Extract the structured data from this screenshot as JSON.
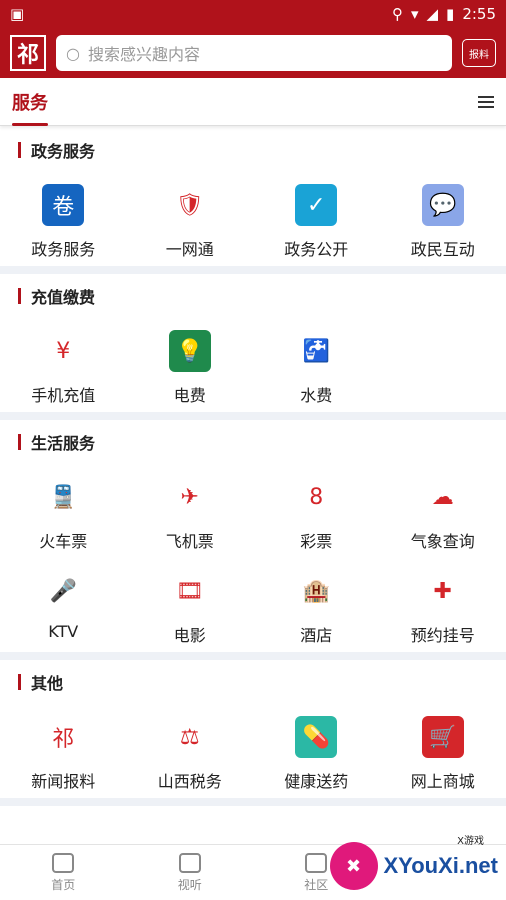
{
  "status_bar": {
    "time": "2:55"
  },
  "header": {
    "logo_char": "祁",
    "search_placeholder": "搜索感兴趣内容",
    "report_label": "报料"
  },
  "tabs": {
    "active": "服务"
  },
  "sections": [
    {
      "title": "政务服务",
      "items": [
        {
          "label": "政务服务",
          "icon": "gov-service-icon",
          "color": "#1565c0",
          "glyph": "卷"
        },
        {
          "label": "一网通",
          "icon": "police-badge-icon",
          "color": "#ffffff",
          "glyph": "🛡"
        },
        {
          "label": "政务公开",
          "icon": "check-circle-icon",
          "color": "#1aa3d6",
          "glyph": "✓"
        },
        {
          "label": "政民互动",
          "icon": "chat-bubble-icon",
          "color": "#8aa6e8",
          "glyph": "💬"
        }
      ]
    },
    {
      "title": "充值缴费",
      "items": [
        {
          "label": "手机充值",
          "icon": "phone-recharge-icon",
          "color": "#ffffff",
          "glyph": "¥"
        },
        {
          "label": "电费",
          "icon": "electricity-icon",
          "color": "#1f8a4c",
          "glyph": "💡"
        },
        {
          "label": "水费",
          "icon": "water-tap-icon",
          "color": "#ffffff",
          "glyph": "🚰"
        }
      ]
    },
    {
      "title": "生活服务",
      "items": [
        {
          "label": "火车票",
          "icon": "train-icon",
          "color": "#ffffff",
          "glyph": "🚆"
        },
        {
          "label": "飞机票",
          "icon": "airplane-icon",
          "color": "#ffffff",
          "glyph": "✈"
        },
        {
          "label": "彩票",
          "icon": "lottery-icon",
          "color": "#ffffff",
          "glyph": "8"
        },
        {
          "label": "气象查询",
          "icon": "cloud-icon",
          "color": "#ffffff",
          "glyph": "☁"
        },
        {
          "label": "KTV",
          "icon": "microphone-icon",
          "color": "#ffffff",
          "glyph": "🎤"
        },
        {
          "label": "电影",
          "icon": "film-reel-icon",
          "color": "#ffffff",
          "glyph": "🎞"
        },
        {
          "label": "酒店",
          "icon": "hotel-icon",
          "color": "#ffffff",
          "glyph": "🏨"
        },
        {
          "label": "预约挂号",
          "icon": "medical-cross-icon",
          "color": "#ffffff",
          "glyph": "✚"
        }
      ]
    },
    {
      "title": "其他",
      "items": [
        {
          "label": "新闻报料",
          "icon": "news-report-icon",
          "color": "#ffffff",
          "glyph": "祁"
        },
        {
          "label": "山西税务",
          "icon": "tax-emblem-icon",
          "color": "#ffffff",
          "glyph": "⚖"
        },
        {
          "label": "健康送药",
          "icon": "pill-icon",
          "color": "#2bb8a5",
          "glyph": "💊"
        },
        {
          "label": "网上商城",
          "icon": "shopping-cart-icon",
          "color": "#d4262a",
          "glyph": "🛒"
        }
      ]
    }
  ],
  "bottom_nav": [
    {
      "label": "首页",
      "icon": "home-icon"
    },
    {
      "label": "视听",
      "icon": "video-icon"
    },
    {
      "label": "社区",
      "icon": "community-icon"
    }
  ],
  "watermark": {
    "text": "XYouXi.net",
    "small": "X游戏"
  }
}
